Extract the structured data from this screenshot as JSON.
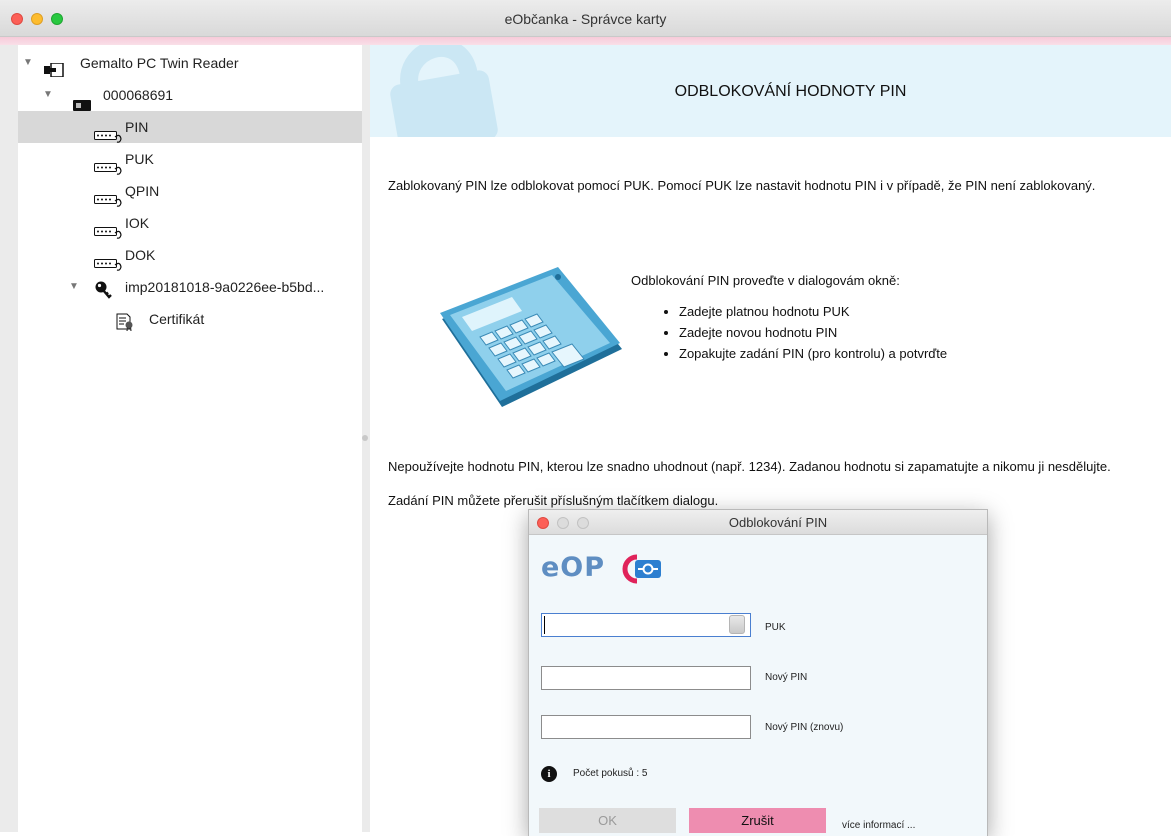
{
  "window": {
    "title": "eObčanka - Správce karty"
  },
  "tree": {
    "reader": "Gemalto PC Twin Reader",
    "card": "000068691",
    "items": [
      "PIN",
      "PUK",
      "QPIN",
      "IOK",
      "DOK"
    ],
    "selected": "PIN",
    "imp": "imp20181018-9a0226ee-b5bd...",
    "certificate": "Certifikát"
  },
  "content": {
    "heading": "ODBLOKOVÁNÍ HODNOTY PIN",
    "intro": "Zablokovaný PIN lze odblokovat pomocí PUK. Pomocí PUK lze nastavit hodnotu PIN i v případě, že PIN není zablokovaný.",
    "instructions_title": "Odblokování PIN proveďte v dialogovám okně:",
    "steps": [
      "Zadejte platnou hodnotu PUK",
      "Zadejte novou hodnotu PIN",
      "Zopakujte zadání PIN (pro kontrolu) a potvrďte"
    ],
    "warning": "Nepoužívejte hodnotu PIN, kterou lze snadno uhodnout (např. 1234). Zadanou hodnotu si zapamatujte a nikomu ji nesdělujte.",
    "cancel_note": "Zadání PIN můžete přerušit příslušným tlačítkem dialogu."
  },
  "dialog": {
    "title": "Odblokování PIN",
    "logo_text": "eOP",
    "fields": [
      {
        "label": "PUK",
        "value": ""
      },
      {
        "label": "Nový PIN",
        "value": ""
      },
      {
        "label": "Nový PIN (znovu)",
        "value": ""
      }
    ],
    "attempts": "Počet pokusů : 5",
    "ok_label": "OK",
    "cancel_label": "Zrušit",
    "more_info": "více informací ..."
  },
  "colors": {
    "accent_pink": "#ee8db0",
    "header_band": "#e4f4fb",
    "calculator_blue": "#4aa6d3"
  }
}
